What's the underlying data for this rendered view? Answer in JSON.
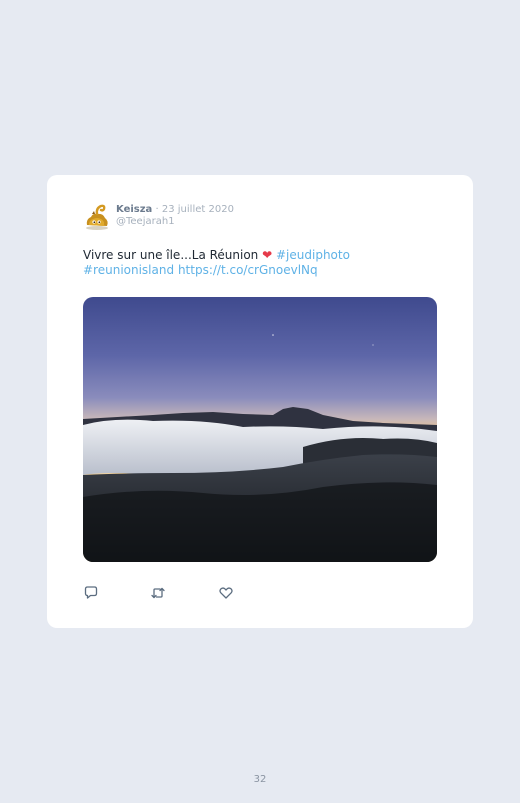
{
  "tweet": {
    "name": "Keisza",
    "separator": "·",
    "date": "23 juillet 2020",
    "handle": "@Teejarah1",
    "text_plain": "Vivre sur une île...La Réunion ",
    "heart": "❤",
    "hashtag1": "#jeudiphoto",
    "hashtag2": "#reunionisland",
    "url": "https://t.co/crGnoevlNq"
  },
  "icons": {
    "reply": "comment-icon",
    "retweet": "retweet-icon",
    "like": "heart-icon"
  },
  "colors": {
    "background": "#e6eaf2",
    "card": "#ffffff",
    "link": "#5fb2e6",
    "heart": "#e53a4a"
  },
  "page": {
    "number": "32"
  }
}
